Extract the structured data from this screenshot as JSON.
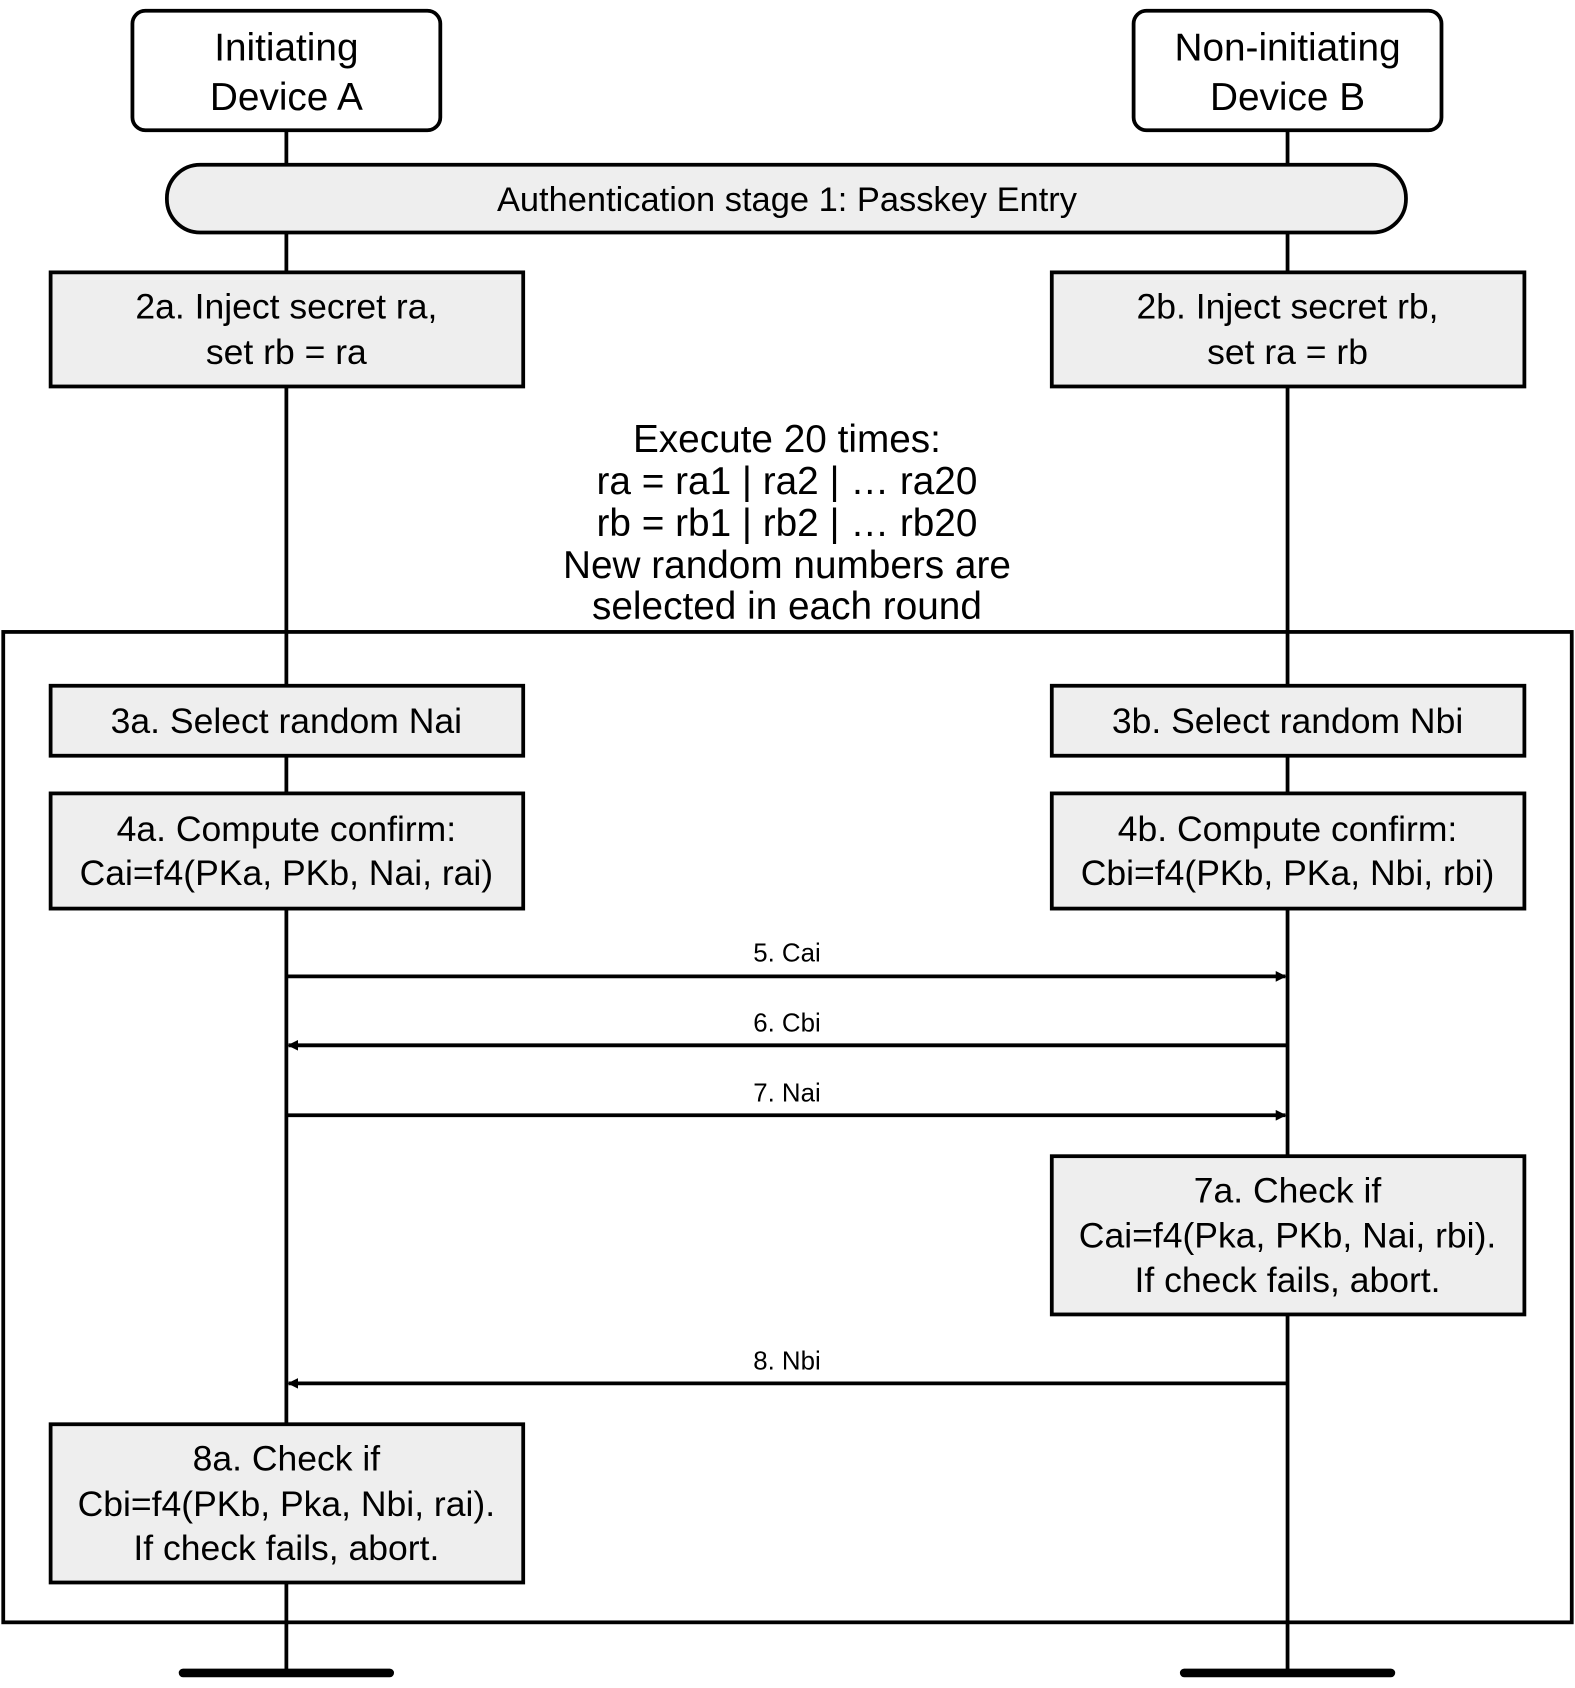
{
  "participants": [
    {
      "lines": [
        "Initiating",
        "Device A"
      ]
    },
    {
      "lines": [
        "Non-initiating",
        "Device B"
      ]
    }
  ],
  "stage": "Authentication stage 1: Passkey Entry",
  "steps": {
    "s2a": [
      "2a. Inject secret ra,",
      "set rb = ra"
    ],
    "s2b": [
      "2b. Inject secret rb,",
      "set ra = rb"
    ],
    "loop": [
      "Execute 20 times:",
      "ra = ra1 | ra2 | … ra20",
      "rb = rb1 | rb2 | … rb20",
      "New random numbers are",
      "selected in each round"
    ],
    "s3a": "3a. Select random Nai",
    "s3b": "3b. Select random Nbi",
    "s4a": [
      "4a. Compute confirm:",
      "Cai=f4(PKa, PKb, Nai, rai)"
    ],
    "s4b": [
      "4b. Compute confirm:",
      "Cbi=f4(PKb, PKa, Nbi, rbi)"
    ],
    "s7a": [
      "7a. Check if",
      "Cai=f4(Pka, PKb, Nai, rbi).",
      "If check fails, abort."
    ],
    "s8a": [
      "8a. Check if",
      "Cbi=f4(PKb, Pka, Nbi, rai).",
      "If check fails, abort."
    ]
  },
  "messages": [
    {
      "label": "5. Cai",
      "direction": "A-to-B"
    },
    {
      "label": "6. Cbi",
      "direction": "B-to-A"
    },
    {
      "label": "7. Nai",
      "direction": "A-to-B"
    },
    {
      "label": "8. Nbi",
      "direction": "B-to-A"
    }
  ],
  "colors": {
    "box_fill": "#eeeeee",
    "line": "#000000"
  }
}
